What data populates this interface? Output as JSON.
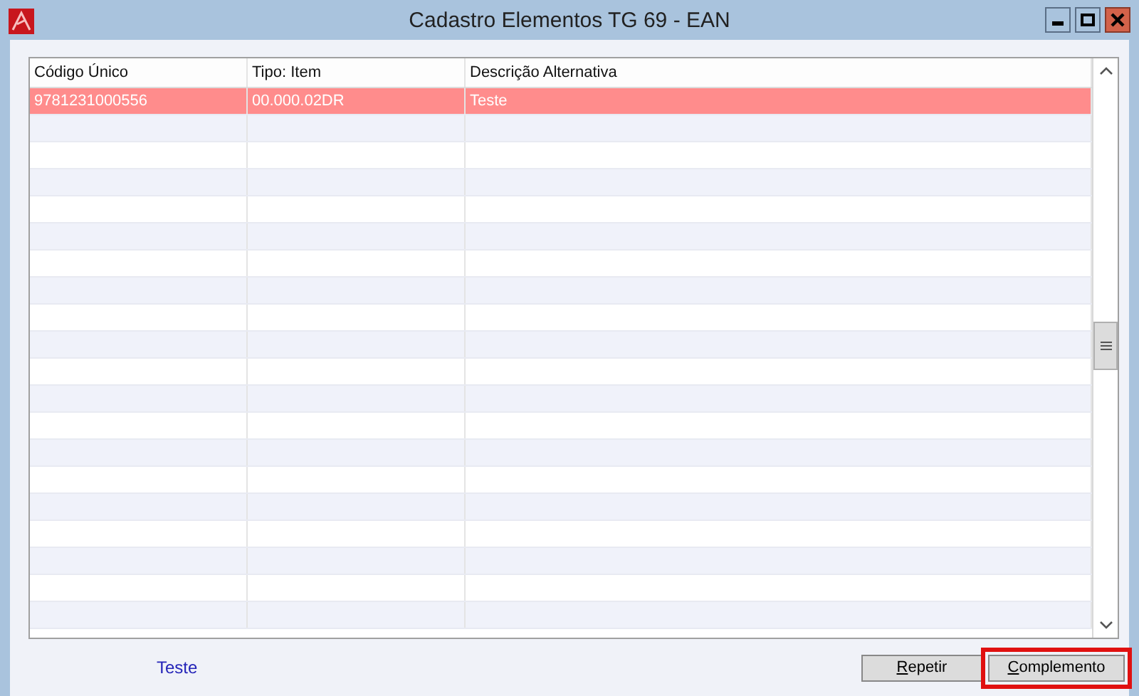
{
  "window": {
    "title": "Cadastro Elementos TG 69 - EAN"
  },
  "table": {
    "columns": [
      "Código Único",
      "Tipo: Item",
      "Descrição Alternativa"
    ],
    "rows": [
      {
        "cells": [
          "9781231000556",
          "00.000.02DR",
          "Teste"
        ],
        "selected": true
      }
    ]
  },
  "footer_label": "Teste",
  "buttons": [
    {
      "label": "Repetir",
      "focused": false
    },
    {
      "label": "Complemento",
      "focused": true
    }
  ]
}
